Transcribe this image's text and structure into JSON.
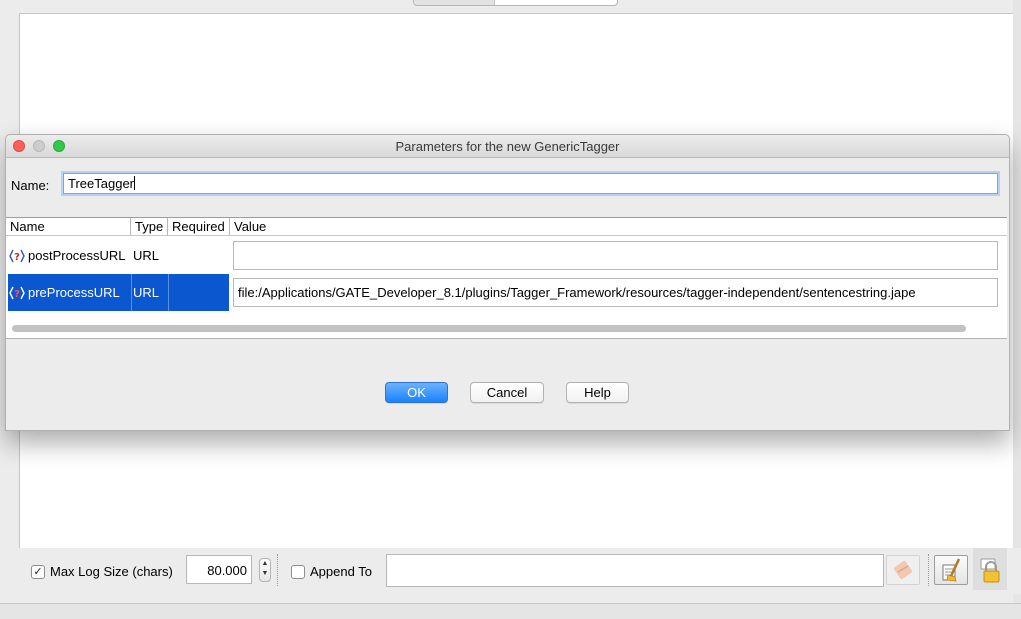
{
  "dialog": {
    "title": "Parameters for the new GenericTagger",
    "name_label": "Name:",
    "name_value": "TreeTagger",
    "table": {
      "columns": [
        "Name",
        "Type",
        "Required",
        "Value"
      ],
      "rows": [
        {
          "name": "postProcessURL",
          "type": "URL",
          "required": "",
          "value": "",
          "icon": "optional-parameter-icon",
          "selected": false
        },
        {
          "name": "preProcessURL",
          "type": "URL",
          "required": "",
          "value": "file:/Applications/GATE_Developer_8.1/plugins/Tagger_Framework/resources/tagger-independent/sentencestring.jape",
          "icon": "required-parameter-icon",
          "selected": true
        }
      ]
    },
    "buttons": {
      "ok": "OK",
      "cancel": "Cancel",
      "help": "Help"
    }
  },
  "log_bar": {
    "max_log_checked": true,
    "max_log_label": "Max Log Size (chars)",
    "max_log_value": "80.000",
    "append_checked": false,
    "append_label": "Append To",
    "append_path": "",
    "icons": [
      "clear-file-icon",
      "clear-log-icon",
      "lock-icon"
    ]
  },
  "colors": {
    "selection": "#0b57d0",
    "default_button": "#1a82fb",
    "focus_ring": "#7ba7de"
  }
}
